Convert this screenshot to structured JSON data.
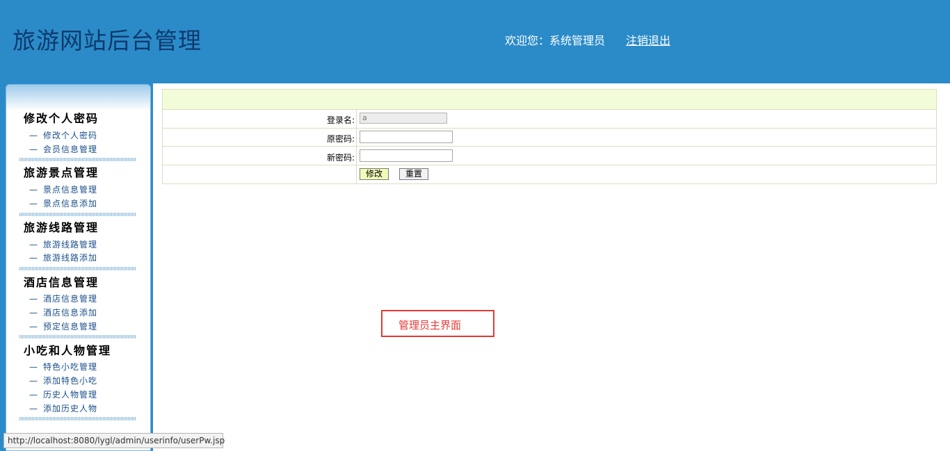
{
  "header": {
    "site_title": "旅游网站后台管理",
    "welcome_text": "欢迎您：系统管理员",
    "logout_label": "注销退出"
  },
  "sidebar": {
    "groups": [
      {
        "title": "修改个人密码",
        "items": [
          {
            "label": "修改个人密码"
          },
          {
            "label": "会员信息管理"
          }
        ]
      },
      {
        "title": "旅游景点管理",
        "items": [
          {
            "label": "景点信息管理"
          },
          {
            "label": "景点信息添加"
          }
        ]
      },
      {
        "title": "旅游线路管理",
        "items": [
          {
            "label": "旅游线路管理"
          },
          {
            "label": "旅游线路添加"
          }
        ]
      },
      {
        "title": "酒店信息管理",
        "items": [
          {
            "label": "酒店信息管理"
          },
          {
            "label": "酒店信息添加"
          },
          {
            "label": "预定信息管理"
          }
        ]
      },
      {
        "title": "小吃和人物管理",
        "items": [
          {
            "label": "特色小吃管理"
          },
          {
            "label": "添加特色小吃"
          },
          {
            "label": "历史人物管理"
          },
          {
            "label": "添加历史人物"
          }
        ]
      }
    ],
    "item_prefix": "—"
  },
  "form": {
    "username_label": "登录名:",
    "username_value": "a",
    "old_password_label": "原密码:",
    "old_password_value": "",
    "new_password_label": "新密码:",
    "new_password_value": "",
    "submit_label": "修改",
    "reset_label": "重置"
  },
  "caption": {
    "text": "管理员主界面",
    "color": "#e53935"
  },
  "status_bar": {
    "url": "http://localhost:8080/lygl/admin/userinfo/userPw.jsp"
  },
  "colors": {
    "header_bg": "#2b8bc8",
    "title_color": "#0d3a6e",
    "form_header_bg": "#f2fcd9",
    "menu_link": "#1a4f8b"
  }
}
